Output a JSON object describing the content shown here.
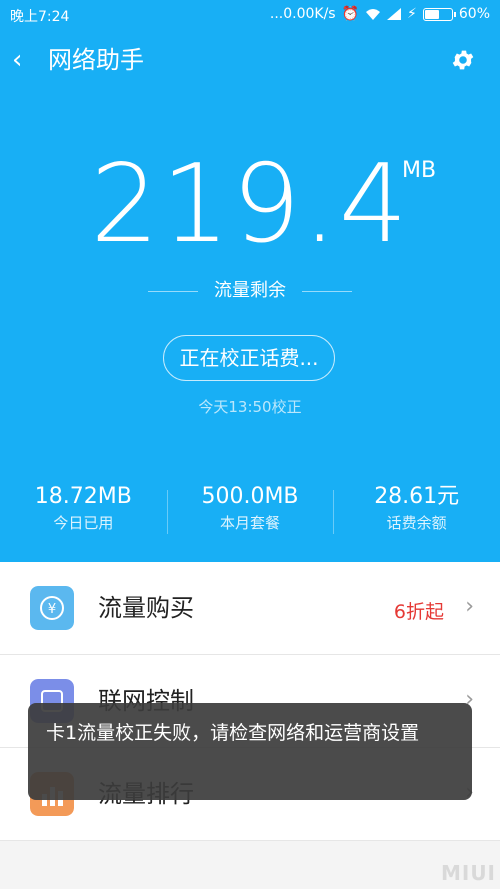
{
  "status_bar": {
    "time": "晚上7:24",
    "speed": "...0.00K/s",
    "battery": "60%",
    "battery_level": 0.6
  },
  "header": {
    "title": "网络助手",
    "back_icon": "chevron-left-icon",
    "settings_icon": "gear-icon"
  },
  "data_remaining": {
    "value": "219.4",
    "unit": "MB",
    "label": "流量剩余"
  },
  "calibration": {
    "button_label": "正在校正话费...",
    "time_text": "今天13:50校正"
  },
  "stats": [
    {
      "value": "18.72MB",
      "label": "今日已用"
    },
    {
      "value": "500.0MB",
      "label": "本月套餐"
    },
    {
      "value": "28.61元",
      "label": "话费余额"
    }
  ],
  "list": [
    {
      "label": "流量购买",
      "extra": "6折起",
      "icon": "yuan-icon",
      "color": "#5bb8ef"
    },
    {
      "label": "联网控制",
      "extra": "",
      "icon": "network-icon",
      "color": "#7b8ee8"
    },
    {
      "label": "流量排行",
      "extra": "",
      "icon": "ranking-icon",
      "color": "#f39a58"
    }
  ],
  "toast": {
    "message": "卡1流量校正失败，请检查网络和运营商设置"
  },
  "watermark": "MIUI",
  "colors": {
    "primary": "#18aff5",
    "accent_red": "#e53935",
    "toast_bg": "#3c3c3c"
  }
}
